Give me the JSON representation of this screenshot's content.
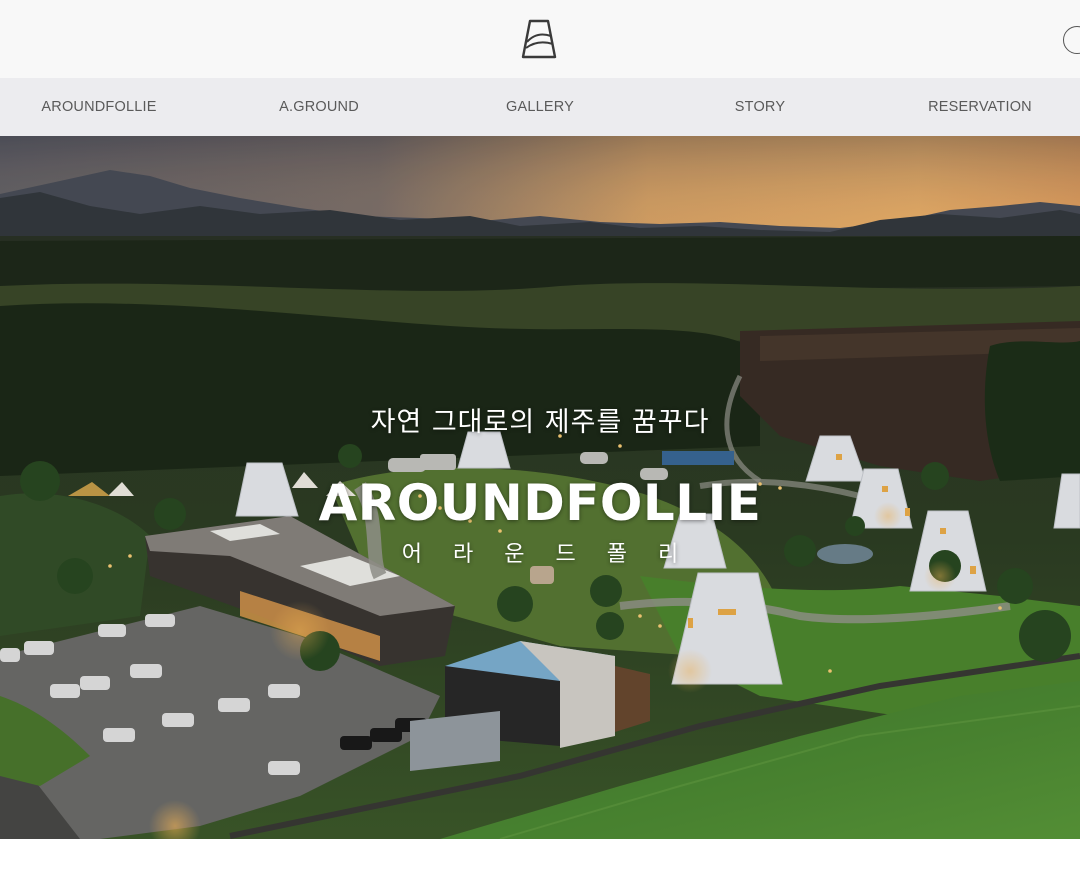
{
  "header": {
    "logo_icon": "aroundfollie-logo-icon",
    "right_icon": "circle-button-icon"
  },
  "nav": {
    "items": [
      {
        "label": "AROUNDFOLLIE"
      },
      {
        "label": "A.GROUND"
      },
      {
        "label": "GALLERY"
      },
      {
        "label": "STORY"
      },
      {
        "label": "RESERVATION"
      }
    ]
  },
  "hero": {
    "tagline": "자연 그대로의 제주를 꿈꾸다",
    "title": "AROUNDFOLLIE",
    "subtitle": "어 라 운 드 폴 리",
    "image": "aerial-sunset-campsite-photo"
  },
  "colors": {
    "header_bg": "#f8f8f8",
    "nav_bg": "#ececef",
    "nav_text": "#5a5a5a",
    "hero_text": "#ffffff"
  }
}
